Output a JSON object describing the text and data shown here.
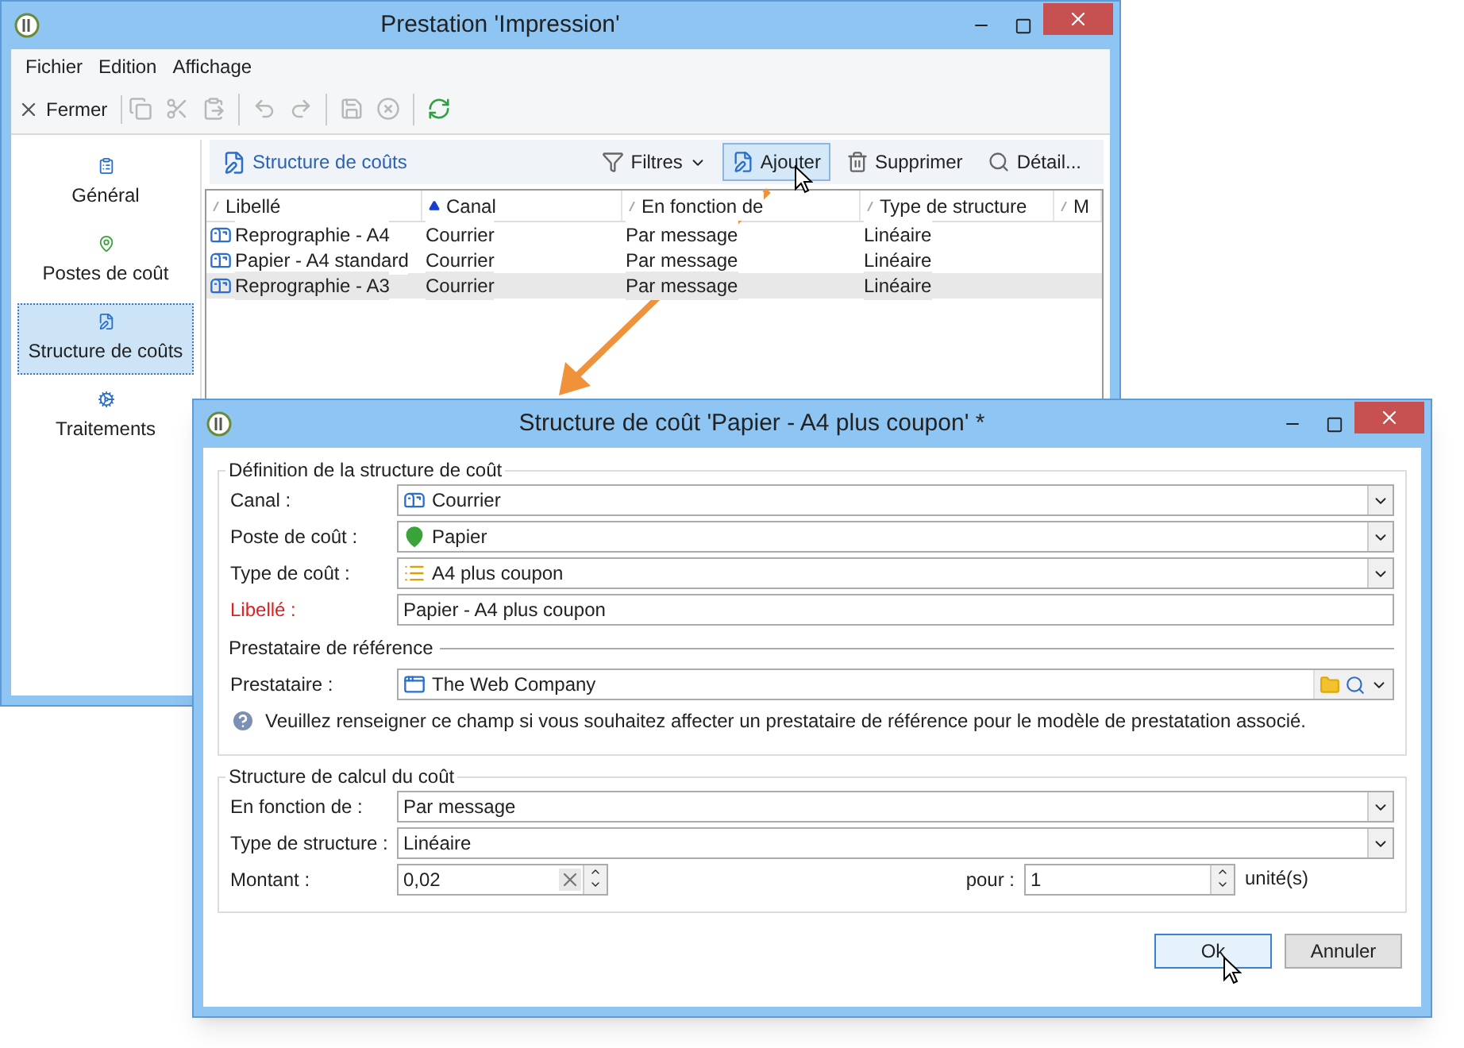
{
  "main_window": {
    "title": "Prestation 'Impression'",
    "menu": [
      "Fichier",
      "Edition",
      "Affichage"
    ],
    "toolbar": {
      "close_label": "Fermer",
      "buttons": [
        {
          "disabled": true
        },
        {
          "disabled": true
        },
        {
          "disabled": true
        },
        {
          "disabled": true
        },
        {
          "disabled": true
        },
        {
          "disabled": true
        },
        {
          "disabled": true
        },
        {
          "disabled": false
        }
      ]
    },
    "sidebar": {
      "items": [
        {
          "label": "Général",
          "selected": false
        },
        {
          "label": "Postes de coût",
          "selected": false
        },
        {
          "label": "Structure de coûts",
          "selected": true
        },
        {
          "label": "Traitements",
          "selected": false
        }
      ]
    },
    "panel": {
      "title": "Structure de coûts",
      "actions": [
        {
          "label": "Filtres",
          "kind": "menu",
          "hovered": false
        },
        {
          "label": "Ajouter",
          "kind": "button",
          "hovered": true
        },
        {
          "label": "Supprimer",
          "kind": "button",
          "hovered": false
        },
        {
          "label": "Détail...",
          "kind": "button",
          "hovered": false
        }
      ]
    },
    "table": {
      "columns": [
        {
          "label": "Libellé",
          "sorted": false
        },
        {
          "label": "Canal",
          "sorted": true
        },
        {
          "label": "En fonction de",
          "sorted": false
        },
        {
          "label": "Type de structure",
          "sorted": false
        },
        {
          "label": "M",
          "sorted": false
        }
      ],
      "rows": [
        {
          "cells": [
            "Reprographie - A4",
            "Courrier",
            "Par message",
            "Linéaire"
          ],
          "selected": false
        },
        {
          "cells": [
            "Papier - A4 standard",
            "Courrier",
            "Par message",
            "Linéaire"
          ],
          "selected": false
        },
        {
          "cells": [
            "Reprographie - A3",
            "Courrier",
            "Par message",
            "Linéaire"
          ],
          "selected": true
        }
      ]
    }
  },
  "dialog": {
    "title": "Structure de coût 'Papier - A4 plus coupon' *",
    "definition": {
      "legend": "Définition de la structure de coût",
      "fields": [
        {
          "label": "Canal :",
          "kind": "combo",
          "value": "Courrier",
          "required": false
        },
        {
          "label": "Poste de coût :",
          "kind": "combo",
          "value": "Papier",
          "required": false
        },
        {
          "label": "Type de coût :",
          "kind": "combo",
          "value": "A4 plus coupon",
          "required": false
        },
        {
          "label": "Libellé :",
          "kind": "text",
          "value": "Papier - A4 plus coupon",
          "required": true
        }
      ]
    },
    "reference": {
      "legend": "Prestataire de référence",
      "field": {
        "label": "Prestataire :",
        "value": "The Web Company"
      },
      "help": "Veuillez renseigner ce champ si vous souhaitez affecter un prestataire de référence pour le modèle de prestatation associé."
    },
    "calculation": {
      "legend": "Structure de calcul du coût",
      "fields": [
        {
          "label": "En fonction de :",
          "value": "Par message"
        },
        {
          "label": "Type de structure :",
          "value": "Linéaire"
        }
      ],
      "amount": {
        "label": "Montant :",
        "value": "0,02"
      },
      "per": {
        "label": "pour :",
        "value": "1",
        "unit": "unité(s)"
      }
    },
    "buttons": [
      {
        "label": "Ok",
        "default": true
      },
      {
        "label": "Annuler",
        "default": false
      }
    ]
  }
}
